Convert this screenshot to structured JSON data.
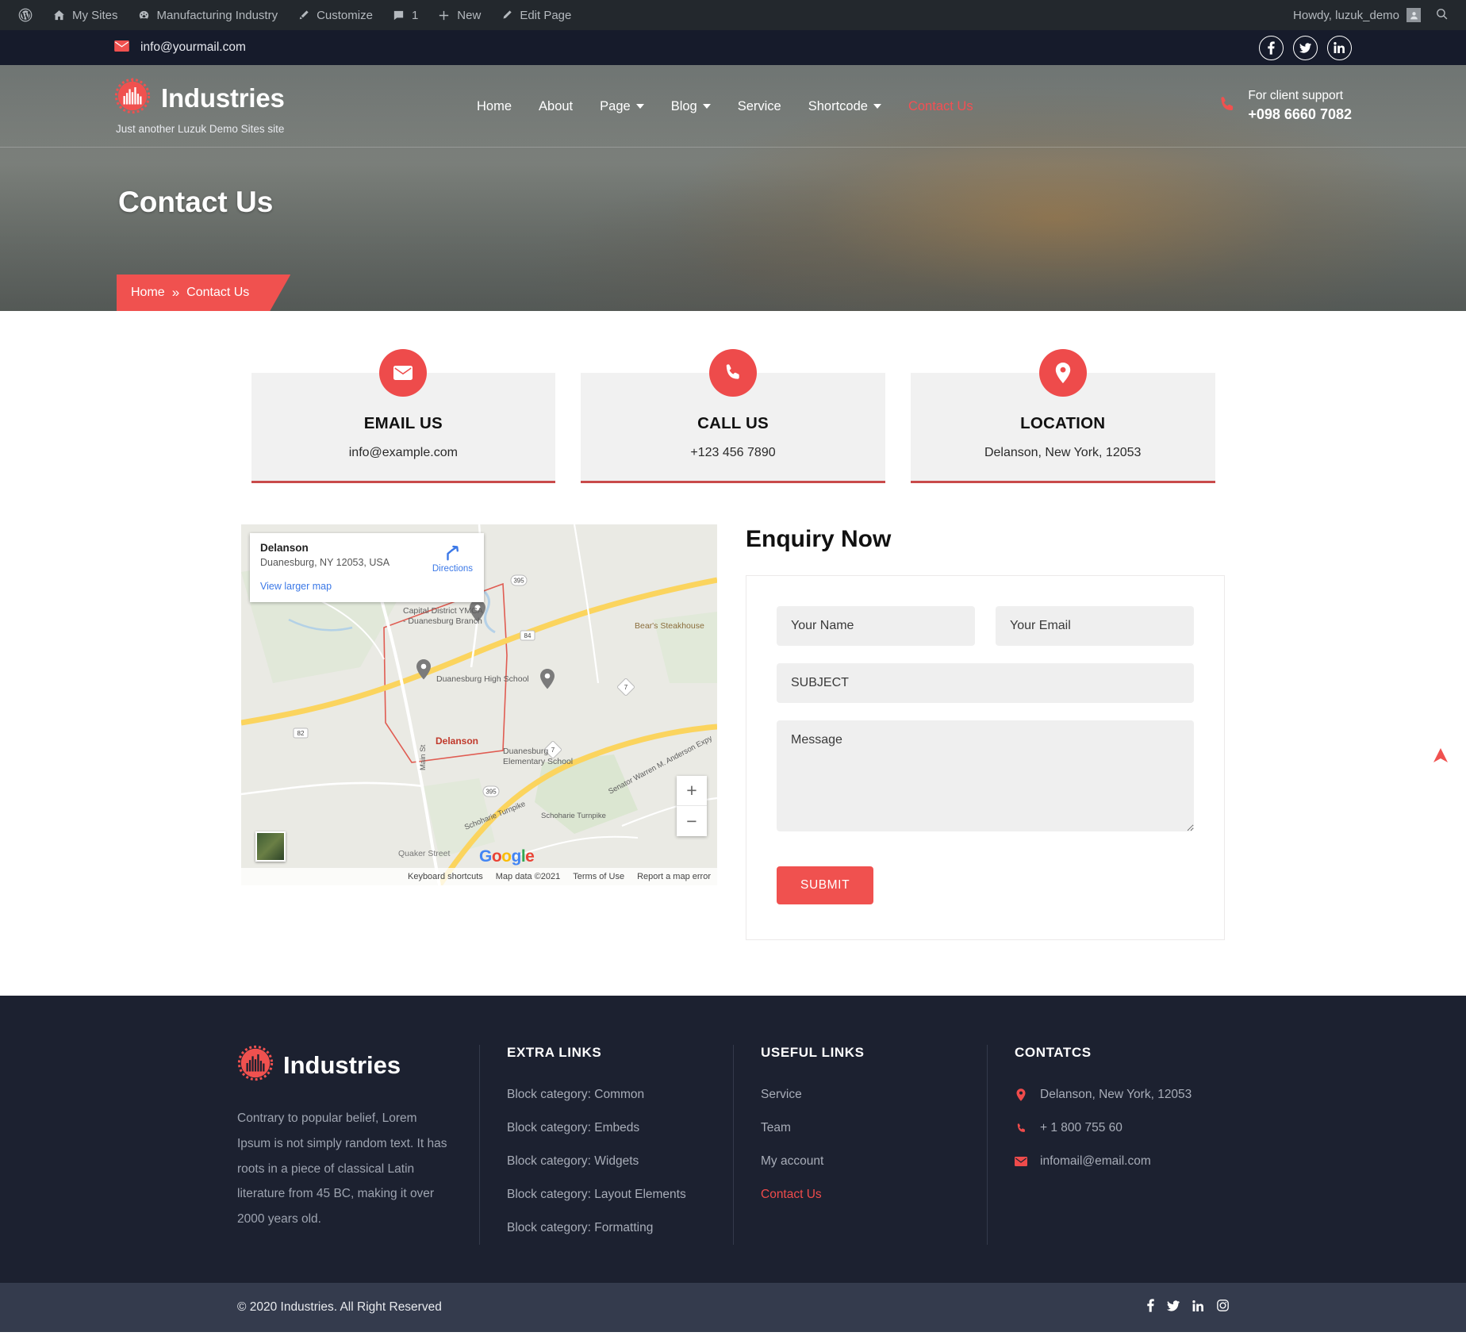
{
  "adminbar": {
    "items": [
      {
        "icon": "wordpress-icon",
        "label": ""
      },
      {
        "icon": "my-sites-icon",
        "label": "My Sites"
      },
      {
        "icon": "site-icon",
        "label": "Manufacturing Industry"
      },
      {
        "icon": "customize-icon",
        "label": "Customize"
      },
      {
        "icon": "comments-icon",
        "label": "1"
      },
      {
        "icon": "plus-icon",
        "label": "New"
      },
      {
        "icon": "edit-icon",
        "label": "Edit Page"
      }
    ],
    "howdy": "Howdy, luzuk_demo",
    "search_icon": "search-icon"
  },
  "topbar": {
    "email": "info@yourmail.com",
    "mail_icon": "envelope-icon",
    "social": [
      {
        "name": "facebook-icon",
        "glyph": "f"
      },
      {
        "name": "twitter-icon",
        "glyph": "t"
      },
      {
        "name": "linkedin-icon",
        "glyph": "in"
      }
    ]
  },
  "header": {
    "brand_name": "Industries",
    "tagline": "Just another Luzuk Demo Sites site",
    "logo_icon": "gear-factory-logo-icon",
    "nav": [
      {
        "label": "Home",
        "dropdown": false,
        "active": false
      },
      {
        "label": "About",
        "dropdown": false,
        "active": false
      },
      {
        "label": "Page",
        "dropdown": true,
        "active": false
      },
      {
        "label": "Blog",
        "dropdown": true,
        "active": false
      },
      {
        "label": "Service",
        "dropdown": false,
        "active": false
      },
      {
        "label": "Shortcode",
        "dropdown": true,
        "active": false
      },
      {
        "label": "Contact Us",
        "dropdown": false,
        "active": true
      }
    ],
    "support_label": "For client support",
    "support_phone": "+098 6660 7082",
    "phone_icon": "phone-icon"
  },
  "banner": {
    "title": "Contact Us",
    "breadcrumb_home": "Home",
    "breadcrumb_sep": "»",
    "breadcrumb_current": "Contact Us"
  },
  "cards": [
    {
      "icon": "envelope-icon",
      "title": "EMAIL US",
      "value": "info@example.com"
    },
    {
      "icon": "phone-icon",
      "title": "CALL US",
      "value": "+123 456 7890"
    },
    {
      "icon": "map-pin-icon",
      "title": "LOCATION",
      "value": "Delanson, New York, 12053"
    }
  ],
  "map": {
    "place": "Delanson",
    "address": "Duanesburg, NY 12053, USA",
    "directions": "Directions",
    "directions_icon": "directions-arrow-icon",
    "view_larger": "View larger map",
    "zoom_in": "+",
    "zoom_out": "−",
    "brand": "Google",
    "footer": [
      "Keyboard shortcuts",
      "Map data ©2021",
      "Terms of Use",
      "Report a map error"
    ],
    "labels": [
      "Capital District YMCA - Duanesburg Branch",
      "Bear's Steakhouse",
      "Duanesburg High School",
      "Delanson",
      "Duanesburg Elementary School",
      "Senator Warren M. Anderson Expy",
      "Schoharie Turnpike",
      "Main St",
      "Quaker Street",
      "395",
      "84",
      "7",
      "82"
    ]
  },
  "form": {
    "title": "Enquiry Now",
    "name_placeholder": "Your Name",
    "email_placeholder": "Your Email",
    "subject_placeholder": "SUBJECT",
    "message_placeholder": "Message",
    "submit_label": "SUBMIT",
    "name_value": "",
    "email_value": "",
    "subject_value": "",
    "message_value": ""
  },
  "footer": {
    "brand_name": "Industries",
    "logo_icon": "gear-factory-logo-icon",
    "about": "Contrary to popular belief, Lorem Ipsum is not simply random text. It has roots in a piece of classical Latin literature from 45 BC, making it over 2000 years old.",
    "extra_links_head": "EXTRA LINKS",
    "extra_links": [
      "Block category: Common",
      "Block category: Embeds",
      "Block category: Widgets",
      "Block category: Layout Elements",
      "Block category: Formatting"
    ],
    "useful_links_head": "USEFUL LINKS",
    "useful_links": [
      {
        "label": "Service",
        "active": false
      },
      {
        "label": "Team",
        "active": false
      },
      {
        "label": "My account",
        "active": false
      },
      {
        "label": "Contact Us",
        "active": true
      }
    ],
    "contacts_head": "CONTATCS",
    "contacts": [
      {
        "icon": "map-pin-icon",
        "value": "Delanson, New York, 12053"
      },
      {
        "icon": "phone-icon",
        "value": "+ 1 800 755 60"
      },
      {
        "icon": "envelope-icon",
        "value": "infomail@email.com"
      }
    ],
    "copyright": "© 2020 Industries. All Right Reserved",
    "social": [
      "facebook-icon",
      "twitter-icon",
      "linkedin-icon",
      "instagram-icon"
    ]
  },
  "colors": {
    "accent": "#f0514f",
    "accent_dark": "#ee4b4b",
    "admin_bar": "#23282d",
    "topbar": "#161b2b",
    "footer": "#1c2130",
    "footer_bottom": "#343b4d"
  }
}
